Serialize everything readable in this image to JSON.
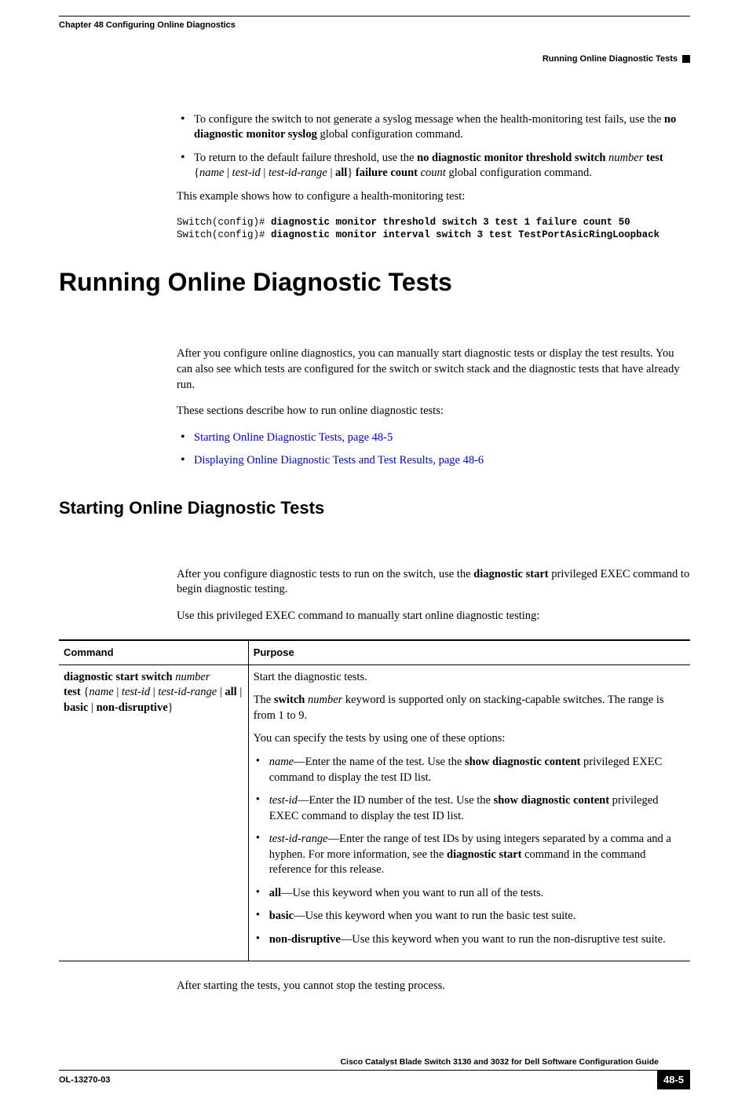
{
  "header": {
    "chapter": "Chapter 48    Configuring Online Diagnostics",
    "section": "Running Online Diagnostic Tests"
  },
  "top_bullets": [
    {
      "pre": "To configure the switch to not generate a syslog message when the health-monitoring test fails, use the ",
      "bold1": "no diagnostic monitor syslog",
      "post1": " global configuration command."
    },
    {
      "pre": "To return to the default failure threshold, use the ",
      "bold1": "no diagnostic monitor threshold switch",
      "italic1": " number ",
      "bold2": "test",
      "post_brace_open": " {",
      "italic2": "name",
      "sep1": " | ",
      "italic3": "test-id",
      "sep2": " | ",
      "italic4": "test-id-range",
      "sep3": " | ",
      "bold3": "all",
      "post_brace_close": "} ",
      "bold4": "failure count",
      "italic5": " count",
      "tail": " global configuration command."
    }
  ],
  "example_intro": "This example shows how to configure a health-monitoring test:",
  "code": {
    "line1_prompt": "Switch(config)# ",
    "line1_cmd": "diagnostic monitor threshold switch 3 test 1 failure count 50",
    "line2_prompt": "Switch(config)# ",
    "line2_cmd": "diagnostic monitor interval switch 3 test TestPortAsicRingLoopback"
  },
  "h1": "Running Online Diagnostic Tests",
  "running_para1": "After you configure online diagnostics, you can manually start diagnostic tests or display the test results. You can also see which tests are configured for the switch or switch stack and the diagnostic tests that have already run.",
  "running_para2": "These sections describe how to run online diagnostic tests:",
  "running_links": [
    "Starting Online Diagnostic Tests, page 48-5",
    "Displaying Online Diagnostic Tests and Test Results, page 48-6"
  ],
  "h2": "Starting Online Diagnostic Tests",
  "starting_para1_pre": "After you configure diagnostic tests to run on the switch, use the ",
  "starting_para1_bold": "diagnostic start",
  "starting_para1_post": " privileged EXEC command to begin diagnostic testing.",
  "starting_para2": "Use this privileged EXEC command to manually start online diagnostic testing:",
  "table": {
    "col1": "Command",
    "col2": "Purpose",
    "command": {
      "l1_bold": "diagnostic start switch",
      "l1_it": " number",
      "l2_bold": "test",
      "l2_brace_open": " {",
      "l2_it1": "name",
      "sep": " | ",
      "l2_it2": "test-id",
      "l2_it3": "test-id-range",
      "l2_bold2": "all",
      "l2_bold3": "basic",
      "l2_bold4": "non-disruptive",
      "l2_brace_close": "}"
    },
    "purpose": {
      "p1": "Start the diagnostic tests.",
      "p2_pre": "The ",
      "p2_bold": "switch",
      "p2_it": " number",
      "p2_post": " keyword is supported only on stacking-capable switches. The range is from 1 to 9.",
      "p3": "You can specify the tests by using one of these options:",
      "opts": [
        {
          "it": "name",
          "pre": "—Enter the name of the test. Use the ",
          "bold": "show diagnostic content",
          "post": " privileged EXEC command to display the test ID list."
        },
        {
          "it": "test-id",
          "pre": "—Enter the ID number of the test. Use the ",
          "bold": "show diagnostic content",
          "post": " privileged EXEC command to display the test ID list."
        },
        {
          "it": "test-id-range",
          "pre": "—Enter the range of test IDs by using integers separated by a comma and a hyphen. For more information, see the ",
          "bold": "diagnostic start",
          "post": " command in the command reference for this release."
        },
        {
          "bold_first": "all",
          "post": "—Use this keyword when you want to run all of the tests."
        },
        {
          "bold_first": "basic",
          "post": "—Use this keyword when you want to run the basic test suite."
        },
        {
          "bold_first": "non-disruptive",
          "post": "—Use this keyword when you want to run the non-disruptive test suite."
        }
      ]
    }
  },
  "closing": "After starting the tests, you cannot stop the testing process.",
  "footer": {
    "title": "Cisco Catalyst Blade Switch 3130 and 3032 for Dell Software Configuration Guide",
    "docnum": "OL-13270-03",
    "pagenum": "48-5"
  }
}
